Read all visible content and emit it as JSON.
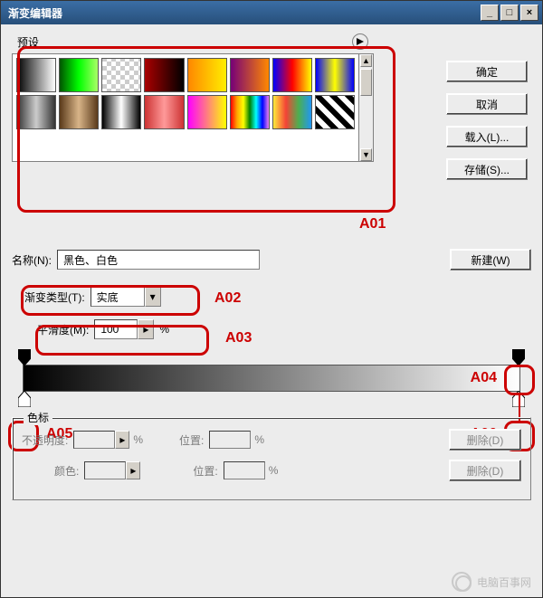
{
  "window": {
    "title": "渐变编辑器"
  },
  "winbuttons": {
    "min": "_",
    "max": "□",
    "close": "×"
  },
  "presets": {
    "legend": "预设"
  },
  "swatches": [
    {
      "bg": "linear-gradient(to right,#000,#fff)"
    },
    {
      "bg": "linear-gradient(to right,#050,#0f0,#af6)"
    },
    {
      "bg": "repeating-conic-gradient(#ccc 0 25%,#fff 0 50%) 0/10px 10px"
    },
    {
      "bg": "linear-gradient(to right,#a00,#500,#000)"
    },
    {
      "bg": "linear-gradient(to right,#f80,#fe0)"
    },
    {
      "bg": "linear-gradient(to right,#707,#f80)"
    },
    {
      "bg": "linear-gradient(to right,#00f,#f00,#ff0)"
    },
    {
      "bg": "linear-gradient(to right,#00f,#ff0,#00f)"
    },
    {
      "bg": "linear-gradient(to right,#333,#ccc,#333)"
    },
    {
      "bg": "linear-gradient(to right,#5a3a1a,#d8b488,#5a3a1a)"
    },
    {
      "bg": "linear-gradient(to right,#000,#fff,#000)"
    },
    {
      "bg": "linear-gradient(to right,#c33,#f99,#c33)"
    },
    {
      "bg": "linear-gradient(to right,#f0f,#ff0)"
    },
    {
      "bg": "linear-gradient(to right,red,orange,yellow,green,cyan,blue,violet)"
    },
    {
      "bg": "linear-gradient(to right,#ffeb3b,#f44336,#4caf50,#2196f3)"
    },
    {
      "bg": "repeating-linear-gradient(45deg,#000 0 6px,#fff 6px 12px)"
    }
  ],
  "buttons": {
    "ok": "确定",
    "cancel": "取消",
    "load": "载入(L)...",
    "save": "存储(S)...",
    "new": "新建(W)"
  },
  "name": {
    "label": "名称(N):",
    "value": "黑色、白色"
  },
  "type": {
    "label": "渐变类型(T):",
    "value": "实底"
  },
  "smooth": {
    "label": "平滑度(M):",
    "value": "100",
    "unit": "%"
  },
  "colorstops_legend": "色标",
  "cs": {
    "opacity_label": "不透明度:",
    "opacity_unit": "%",
    "pos_label": "位置:",
    "pos_unit": "%",
    "delete1": "删除(D)",
    "color_label": "颜色:",
    "pos2_label": "位置:",
    "pos2_unit": "%",
    "delete2": "删除(D)"
  },
  "annotations": {
    "a01": "A01",
    "a02": "A02",
    "a03": "A03",
    "a04": "A04",
    "a05": "A05",
    "a06": "A06"
  },
  "watermark": "电脑百事网"
}
